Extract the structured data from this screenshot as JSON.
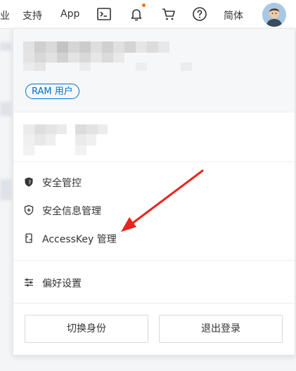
{
  "topbar": {
    "partial_label": "业",
    "support": "支持",
    "app": "App",
    "language": "简体",
    "icons": [
      "terminal-icon",
      "bell-icon",
      "cart-icon",
      "help-icon"
    ]
  },
  "panel": {
    "role_badge": "RAM 用户",
    "menu": [
      {
        "label": "安全管控",
        "icon": "shield-fill-icon"
      },
      {
        "label": "安全信息管理",
        "icon": "shield-plus-icon"
      },
      {
        "label": "AccessKey 管理",
        "icon": "key-icon"
      },
      {
        "label": "偏好设置",
        "icon": "sliders-icon"
      }
    ],
    "switch_identity": "切换身份",
    "logout": "退出登录"
  },
  "colors": {
    "accent": "#0070cc",
    "arrow": "#e8251c",
    "notification": "#ff6a00"
  }
}
